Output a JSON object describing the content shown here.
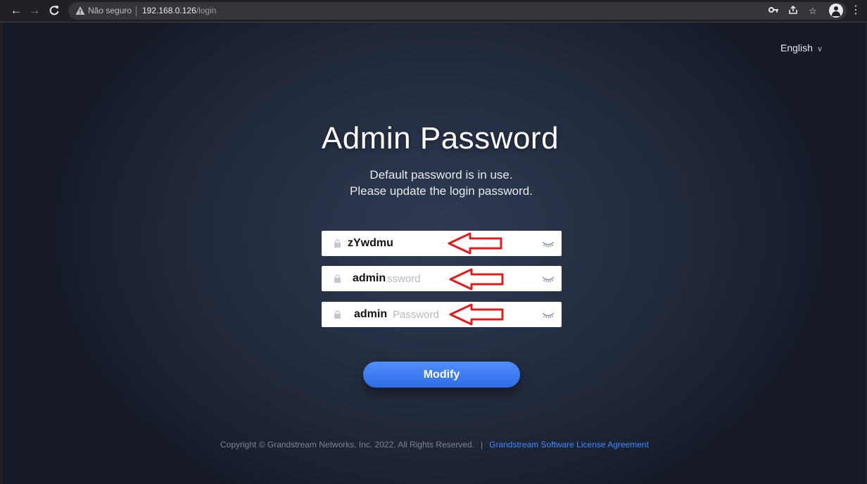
{
  "browser": {
    "security_label": "Não seguro",
    "url_host": "192.168.0.126",
    "url_path": "/login"
  },
  "page": {
    "language": "English",
    "title": "Admin Password",
    "subtitle_line1": "Default password is in use.",
    "subtitle_line2": "Please update the login password.",
    "fields": [
      {
        "value": "zYwdmu",
        "placeholder": ""
      },
      {
        "value": "admin",
        "placeholder": "ssword"
      },
      {
        "value": "admin",
        "placeholder": "Password"
      }
    ],
    "modify_label": "Modify",
    "copyright": "Copyright © Grandstream Networks, Inc. 2022. All Rights Reserved.",
    "footer_separator": "|",
    "license_link": "Grandstream Software License Agreement"
  },
  "colors": {
    "accent": "#3d7bf5",
    "annotation_arrow": "#e01b1b"
  }
}
